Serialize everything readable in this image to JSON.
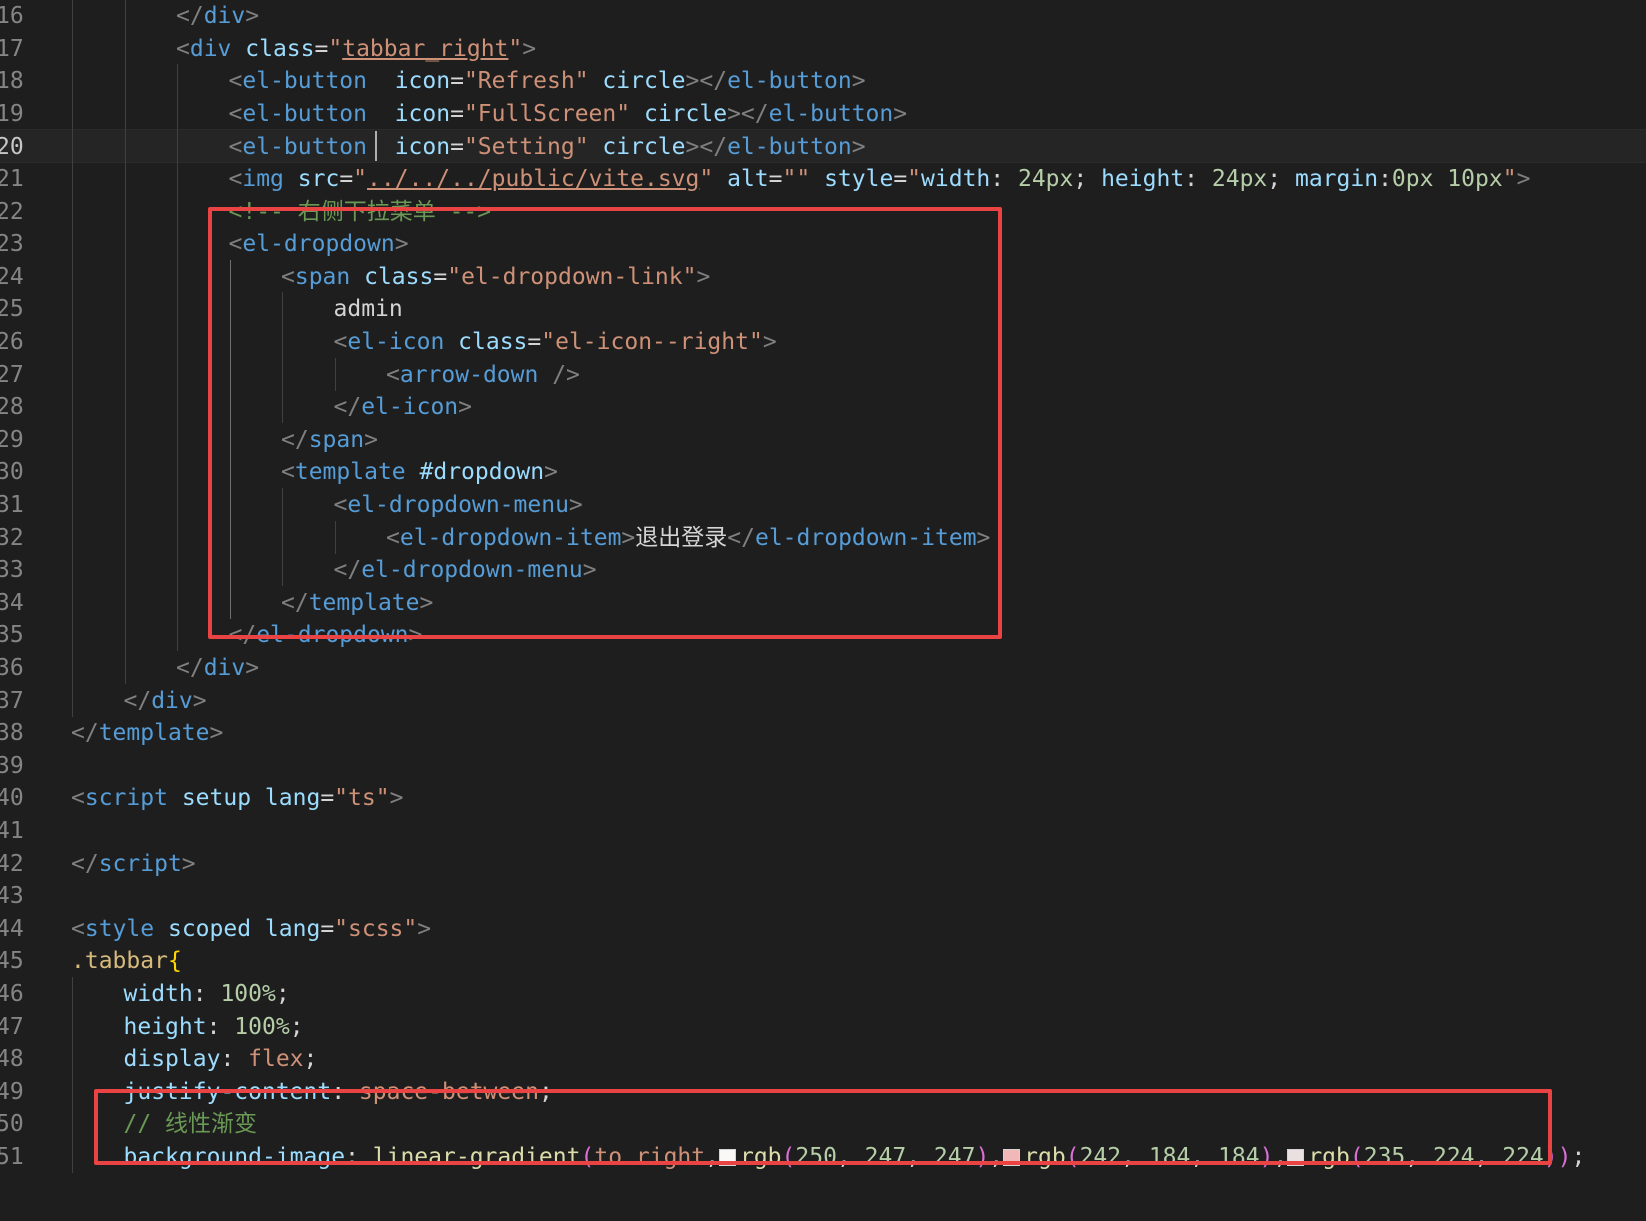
{
  "editor": {
    "language": "vue",
    "highlight_color": "#e94343",
    "current_line": 20
  },
  "lines": [
    {
      "n": "16",
      "indent": 3,
      "tokens": [
        [
          "punc",
          "</"
        ],
        [
          "tag",
          "div"
        ],
        [
          "punc",
          ">"
        ]
      ]
    },
    {
      "n": "17",
      "indent": 3,
      "tokens": [
        [
          "punc",
          "<"
        ],
        [
          "tag",
          "div"
        ],
        [
          "text",
          " "
        ],
        [
          "attr",
          "class"
        ],
        [
          "op",
          "="
        ],
        [
          "str",
          "\""
        ],
        [
          "strlink",
          "tabbar_right"
        ],
        [
          "str",
          "\""
        ],
        [
          "punc",
          ">"
        ]
      ]
    },
    {
      "n": "18",
      "indent": 4,
      "tokens": [
        [
          "punc",
          "<"
        ],
        [
          "tag",
          "el-button"
        ],
        [
          "text",
          "  "
        ],
        [
          "attr",
          "icon"
        ],
        [
          "op",
          "="
        ],
        [
          "str",
          "\"Refresh\""
        ],
        [
          "text",
          " "
        ],
        [
          "attr",
          "circle"
        ],
        [
          "punc",
          "></"
        ],
        [
          "tag",
          "el-button"
        ],
        [
          "punc",
          ">"
        ]
      ]
    },
    {
      "n": "19",
      "indent": 4,
      "tokens": [
        [
          "punc",
          "<"
        ],
        [
          "tag",
          "el-button"
        ],
        [
          "text",
          "  "
        ],
        [
          "attr",
          "icon"
        ],
        [
          "op",
          "="
        ],
        [
          "str",
          "\"FullScreen\""
        ],
        [
          "text",
          " "
        ],
        [
          "attr",
          "circle"
        ],
        [
          "punc",
          "></"
        ],
        [
          "tag",
          "el-button"
        ],
        [
          "punc",
          ">"
        ]
      ]
    },
    {
      "n": "20",
      "indent": 4,
      "tokens": [
        [
          "punc",
          "<"
        ],
        [
          "tag",
          "el-button"
        ],
        [
          "text",
          "  "
        ],
        [
          "attr",
          "icon"
        ],
        [
          "op",
          "="
        ],
        [
          "str",
          "\"Setting\""
        ],
        [
          "text",
          " "
        ],
        [
          "attr",
          "circle"
        ],
        [
          "punc",
          "></"
        ],
        [
          "tag",
          "el-button"
        ],
        [
          "punc",
          ">"
        ]
      ]
    },
    {
      "n": "21",
      "indent": 4,
      "tokens": [
        [
          "punc",
          "<"
        ],
        [
          "tag",
          "img"
        ],
        [
          "text",
          " "
        ],
        [
          "attr",
          "src"
        ],
        [
          "op",
          "="
        ],
        [
          "str",
          "\""
        ],
        [
          "strlink",
          "../../../public/vite.svg"
        ],
        [
          "str",
          "\""
        ],
        [
          "text",
          " "
        ],
        [
          "attr",
          "alt"
        ],
        [
          "op",
          "="
        ],
        [
          "str",
          "\"\""
        ],
        [
          "text",
          " "
        ],
        [
          "attr",
          "style"
        ],
        [
          "op",
          "="
        ],
        [
          "str",
          "\""
        ],
        [
          "prop",
          "width"
        ],
        [
          "op",
          ": "
        ],
        [
          "num",
          "24px"
        ],
        [
          "op",
          "; "
        ],
        [
          "prop",
          "height"
        ],
        [
          "op",
          ": "
        ],
        [
          "num",
          "24px"
        ],
        [
          "op",
          "; "
        ],
        [
          "prop",
          "margin"
        ],
        [
          "op",
          ":"
        ],
        [
          "num",
          "0px 10px"
        ],
        [
          "str",
          "\""
        ],
        [
          "punc",
          ">"
        ]
      ]
    },
    {
      "n": "22",
      "indent": 4,
      "tokens": [
        [
          "comment",
          "<!-- 右侧下拉菜单 -->"
        ]
      ]
    },
    {
      "n": "23",
      "indent": 4,
      "tokens": [
        [
          "punc",
          "<"
        ],
        [
          "tag",
          "el-dropdown"
        ],
        [
          "punc",
          ">"
        ]
      ]
    },
    {
      "n": "24",
      "indent": 5,
      "tokens": [
        [
          "punc",
          "<"
        ],
        [
          "tag",
          "span"
        ],
        [
          "text",
          " "
        ],
        [
          "attr",
          "class"
        ],
        [
          "op",
          "="
        ],
        [
          "str",
          "\"el-dropdown-link\""
        ],
        [
          "punc",
          ">"
        ]
      ]
    },
    {
      "n": "25",
      "indent": 6,
      "tokens": [
        [
          "text",
          "admin"
        ]
      ]
    },
    {
      "n": "26",
      "indent": 6,
      "tokens": [
        [
          "punc",
          "<"
        ],
        [
          "tag",
          "el-icon"
        ],
        [
          "text",
          " "
        ],
        [
          "attr",
          "class"
        ],
        [
          "op",
          "="
        ],
        [
          "str",
          "\"el-icon--right\""
        ],
        [
          "punc",
          ">"
        ]
      ]
    },
    {
      "n": "27",
      "indent": 7,
      "tokens": [
        [
          "punc",
          "<"
        ],
        [
          "tag",
          "arrow-down"
        ],
        [
          "text",
          " "
        ],
        [
          "punc",
          "/>"
        ]
      ]
    },
    {
      "n": "28",
      "indent": 6,
      "tokens": [
        [
          "punc",
          "</"
        ],
        [
          "tag",
          "el-icon"
        ],
        [
          "punc",
          ">"
        ]
      ]
    },
    {
      "n": "29",
      "indent": 5,
      "tokens": [
        [
          "punc",
          "</"
        ],
        [
          "tag",
          "span"
        ],
        [
          "punc",
          ">"
        ]
      ]
    },
    {
      "n": "30",
      "indent": 5,
      "tokens": [
        [
          "punc",
          "<"
        ],
        [
          "tag",
          "template"
        ],
        [
          "text",
          " "
        ],
        [
          "attr",
          "#dropdown"
        ],
        [
          "punc",
          ">"
        ]
      ]
    },
    {
      "n": "31",
      "indent": 6,
      "tokens": [
        [
          "punc",
          "<"
        ],
        [
          "tag",
          "el-dropdown-menu"
        ],
        [
          "punc",
          ">"
        ]
      ]
    },
    {
      "n": "32",
      "indent": 7,
      "tokens": [
        [
          "punc",
          "<"
        ],
        [
          "tag",
          "el-dropdown-item"
        ],
        [
          "punc",
          ">"
        ],
        [
          "text",
          "退出登录"
        ],
        [
          "punc",
          "</"
        ],
        [
          "tag",
          "el-dropdown-item"
        ],
        [
          "punc",
          ">"
        ]
      ]
    },
    {
      "n": "33",
      "indent": 6,
      "tokens": [
        [
          "punc",
          "</"
        ],
        [
          "tag",
          "el-dropdown-menu"
        ],
        [
          "punc",
          ">"
        ]
      ]
    },
    {
      "n": "34",
      "indent": 5,
      "tokens": [
        [
          "punc",
          "</"
        ],
        [
          "tag",
          "template"
        ],
        [
          "punc",
          ">"
        ]
      ]
    },
    {
      "n": "35",
      "indent": 4,
      "tokens": [
        [
          "punc",
          "</"
        ],
        [
          "tag",
          "el-dropdown"
        ],
        [
          "punc",
          ">"
        ]
      ]
    },
    {
      "n": "36",
      "indent": 3,
      "tokens": [
        [
          "punc",
          "</"
        ],
        [
          "tag",
          "div"
        ],
        [
          "punc",
          ">"
        ]
      ]
    },
    {
      "n": "37",
      "indent": 2,
      "tokens": [
        [
          "punc",
          "</"
        ],
        [
          "tag",
          "div"
        ],
        [
          "punc",
          ">"
        ]
      ]
    },
    {
      "n": "38",
      "indent": 1,
      "tokens": [
        [
          "punc",
          "</"
        ],
        [
          "tag",
          "template"
        ],
        [
          "punc",
          ">"
        ]
      ]
    },
    {
      "n": "39",
      "indent": 1,
      "tokens": []
    },
    {
      "n": "40",
      "indent": 1,
      "tokens": [
        [
          "punc",
          "<"
        ],
        [
          "tag",
          "script"
        ],
        [
          "text",
          " "
        ],
        [
          "attr",
          "setup"
        ],
        [
          "text",
          " "
        ],
        [
          "attr",
          "lang"
        ],
        [
          "op",
          "="
        ],
        [
          "str",
          "\"ts\""
        ],
        [
          "punc",
          ">"
        ]
      ]
    },
    {
      "n": "41",
      "indent": 1,
      "tokens": []
    },
    {
      "n": "42",
      "indent": 1,
      "tokens": [
        [
          "punc",
          "</"
        ],
        [
          "tag",
          "script"
        ],
        [
          "punc",
          ">"
        ]
      ]
    },
    {
      "n": "43",
      "indent": 1,
      "tokens": []
    },
    {
      "n": "44",
      "indent": 1,
      "tokens": [
        [
          "punc",
          "<"
        ],
        [
          "tag",
          "style"
        ],
        [
          "text",
          " "
        ],
        [
          "attr",
          "scoped"
        ],
        [
          "text",
          " "
        ],
        [
          "attr",
          "lang"
        ],
        [
          "op",
          "="
        ],
        [
          "str",
          "\"scss\""
        ],
        [
          "punc",
          ">"
        ]
      ]
    },
    {
      "n": "45",
      "indent": 1,
      "tokens": [
        [
          "sel",
          ".tabbar"
        ],
        [
          "brace",
          "{"
        ]
      ]
    },
    {
      "n": "46",
      "indent": 2,
      "tokens": [
        [
          "prop",
          "width"
        ],
        [
          "op",
          ": "
        ],
        [
          "num",
          "100%"
        ],
        [
          "op",
          ";"
        ]
      ]
    },
    {
      "n": "47",
      "indent": 2,
      "tokens": [
        [
          "prop",
          "height"
        ],
        [
          "op",
          ": "
        ],
        [
          "num",
          "100%"
        ],
        [
          "op",
          ";"
        ]
      ]
    },
    {
      "n": "48",
      "indent": 2,
      "tokens": [
        [
          "prop",
          "display"
        ],
        [
          "op",
          ": "
        ],
        [
          "val",
          "flex"
        ],
        [
          "op",
          ";"
        ]
      ]
    },
    {
      "n": "49",
      "indent": 2,
      "tokens": [
        [
          "prop",
          "justify-content"
        ],
        [
          "op",
          ": "
        ],
        [
          "val",
          "space-between"
        ],
        [
          "op",
          ";"
        ]
      ]
    },
    {
      "n": "50",
      "indent": 2,
      "tokens": [
        [
          "comment",
          "// 线性渐变"
        ]
      ]
    },
    {
      "n": "51",
      "indent": 2,
      "tokens": [
        [
          "prop",
          "background-image"
        ],
        [
          "op",
          ": "
        ],
        [
          "fn",
          "linear-gradient"
        ],
        [
          "paren",
          "("
        ],
        [
          "val",
          "to right"
        ],
        [
          "op",
          ","
        ],
        [
          "swatch",
          "#faf7f7"
        ],
        [
          "fn",
          "rgb"
        ],
        [
          "paren",
          "("
        ],
        [
          "num",
          "250"
        ],
        [
          "op",
          ", "
        ],
        [
          "num",
          "247"
        ],
        [
          "op",
          ", "
        ],
        [
          "num",
          "247"
        ],
        [
          "paren",
          ")"
        ],
        [
          "op",
          ","
        ],
        [
          "swatch",
          "#f2b8b8"
        ],
        [
          "fn",
          "rgb"
        ],
        [
          "paren",
          "("
        ],
        [
          "num",
          "242"
        ],
        [
          "op",
          ", "
        ],
        [
          "num",
          "184"
        ],
        [
          "op",
          ", "
        ],
        [
          "num",
          "184"
        ],
        [
          "paren",
          ")"
        ],
        [
          "op",
          ","
        ],
        [
          "swatch",
          "#ebe0e0"
        ],
        [
          "fn",
          "rgb"
        ],
        [
          "paren",
          "("
        ],
        [
          "num",
          "235"
        ],
        [
          "op",
          ", "
        ],
        [
          "num",
          "224"
        ],
        [
          "op",
          ", "
        ],
        [
          "num",
          "224"
        ],
        [
          "paren",
          "))"
        ],
        [
          "op",
          ";"
        ]
      ]
    }
  ]
}
